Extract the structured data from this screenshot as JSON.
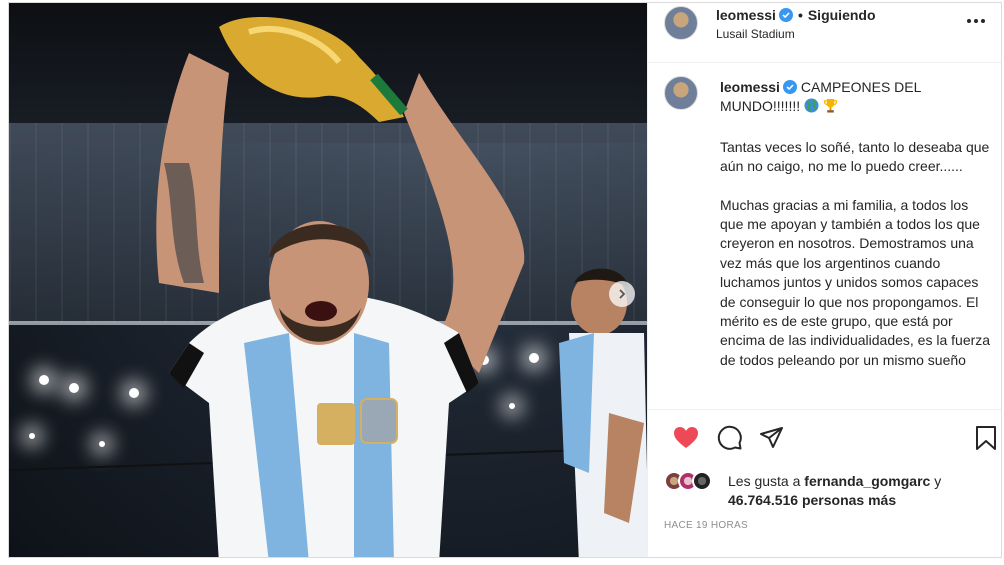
{
  "post": {
    "author": "leomessi",
    "follow_label": "Siguiendo",
    "separator": "•",
    "location": "Lusail Stadium",
    "caption_head": "CAMPEONES DEL MUNDO!!!!!!!",
    "caption_paragraphs": [
      "Tantas veces lo soñé, tanto lo deseaba que aún no caigo, no me lo puedo creer......",
      "Muchas gracias a mi familia, a todos los que me apoyan y también a todos los que creyeron en nosotros. Demostramos una vez más que los argentinos cuando luchamos juntos y unidos somos capaces de conseguir lo que nos propongamos. El mérito es de este grupo, que está por encima de las individualidades, es la fuerza de todos peleando por un mismo sueño"
    ],
    "likes_prefix": "Les gusta a",
    "liked_by": "fernanda_gomgarc",
    "likes_joiner": "y",
    "likes_count": "46.764.516 personas más",
    "timestamp": "HACE 19 HORAS"
  },
  "colors": {
    "heart": "#ed4956",
    "verified": "#3897f0",
    "text": "#262626",
    "muted": "#8e8e8e"
  },
  "icons": [
    "verified-icon",
    "more-options-icon",
    "globe-emoji",
    "trophy-emoji",
    "heart-icon",
    "comment-icon",
    "share-icon",
    "bookmark-icon",
    "next-arrow-icon"
  ]
}
